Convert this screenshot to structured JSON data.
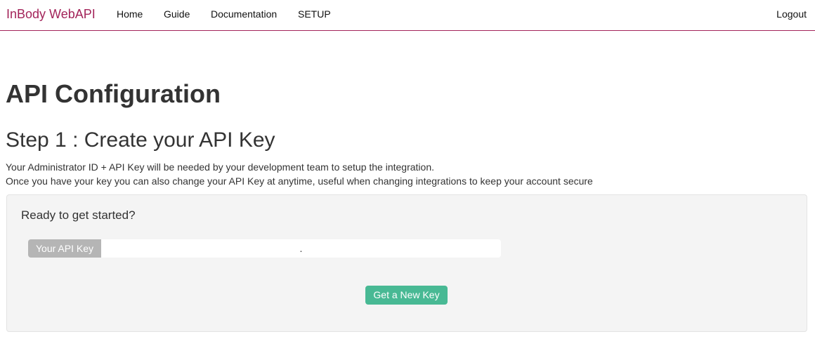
{
  "navbar": {
    "brand": "InBody WebAPI",
    "links": [
      {
        "label": "Home"
      },
      {
        "label": "Guide"
      },
      {
        "label": "Documentation"
      },
      {
        "label": "SETUP"
      }
    ],
    "logout_label": "Logout",
    "accent_color": "#a3245a"
  },
  "page": {
    "title": "API Configuration",
    "step_title": "Step 1 : Create your API Key",
    "description_lines": [
      "Your Administrator ID + API Key will be needed by your development team to setup the integration.",
      "Once you have your key you can also change your API Key at anytime, useful when changing integrations to keep your account secure"
    ]
  },
  "panel": {
    "heading": "Ready to get started?",
    "api_key_label": "Your API Key",
    "api_key_value": ".",
    "button_label": "Get a New Key",
    "button_color": "#48b994"
  }
}
